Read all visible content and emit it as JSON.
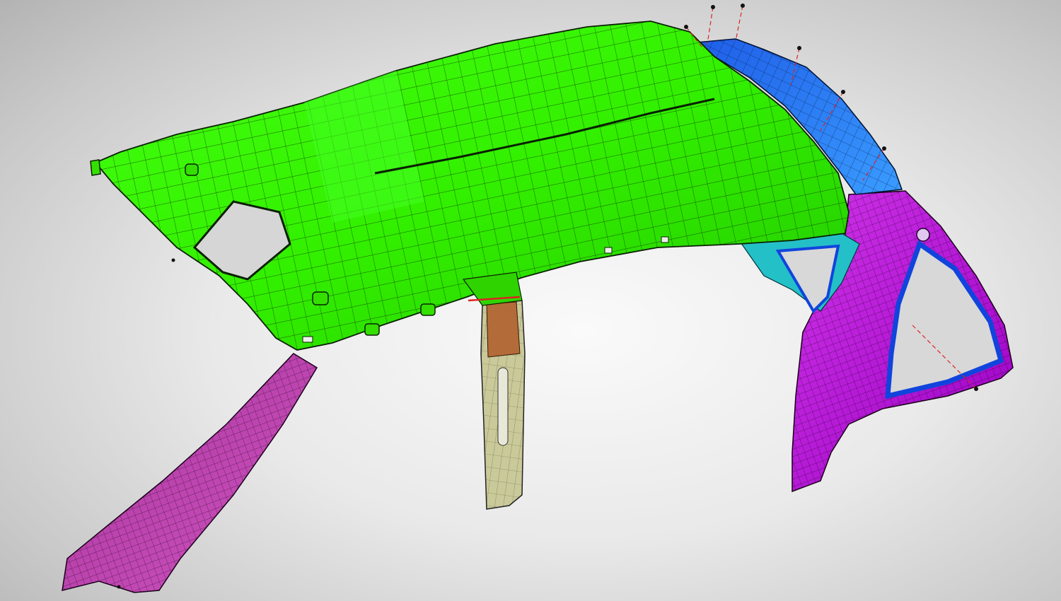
{
  "scene": {
    "description_colors": {
      "background": "#e6e6e6",
      "headliner": "#33ff00",
      "headliner_shade": "#22cc00",
      "a_pillar": "#cc44bb",
      "b_pillar": "#c8c89a",
      "b_pillar_top": "#b06a3a",
      "c_pillar": "#bb00dd",
      "rear_header": "#2f7fff",
      "window_frame": "#1144dd",
      "mesh_line": "#0c2a00",
      "annotation_line": "#dd2222",
      "marker_dot": "#111111"
    },
    "parts": [
      "headliner",
      "a-pillar-trim",
      "b-pillar-trim",
      "c-pillar-trim",
      "rear-roof-header",
      "annotation-markers"
    ]
  }
}
